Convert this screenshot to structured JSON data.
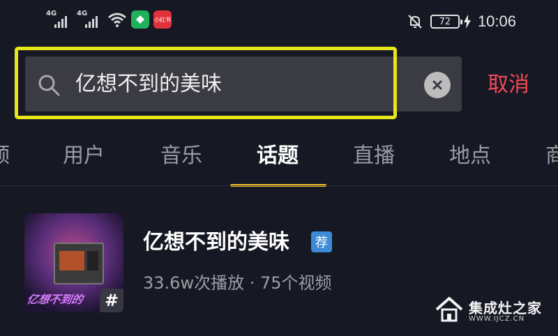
{
  "status_bar": {
    "sim1": "4G",
    "sim2": "4G",
    "app_badge_red": "小红书",
    "battery": "72",
    "time": "10:06"
  },
  "search": {
    "query": "亿想不到的美味",
    "cancel_label": "取消"
  },
  "tabs": [
    {
      "label": "颈"
    },
    {
      "label": "用户"
    },
    {
      "label": "音乐"
    },
    {
      "label": "话题"
    },
    {
      "label": "直播"
    },
    {
      "label": "地点"
    },
    {
      "label": "商"
    }
  ],
  "active_tab": "话题",
  "result": {
    "title": "亿想不到的美味",
    "badge": "荐",
    "meta": "33.6w次播放 · 75个视频",
    "thumbnail_caption": "亿想不到的",
    "thumbnail_tag": "#"
  },
  "watermark": {
    "name": "集成灶之家",
    "url": "WWW.IJCZ.CN"
  },
  "colors": {
    "background": "#161823",
    "highlight_outline": "#e6e61b",
    "tab_underline": "#f7c427",
    "cancel": "#f24b57",
    "badge": "#3d8bd6"
  },
  "icons": [
    "search-icon",
    "clear-icon",
    "wifi-icon",
    "bell-off-icon",
    "charging-icon",
    "hashtag-icon",
    "home-logo-icon"
  ]
}
